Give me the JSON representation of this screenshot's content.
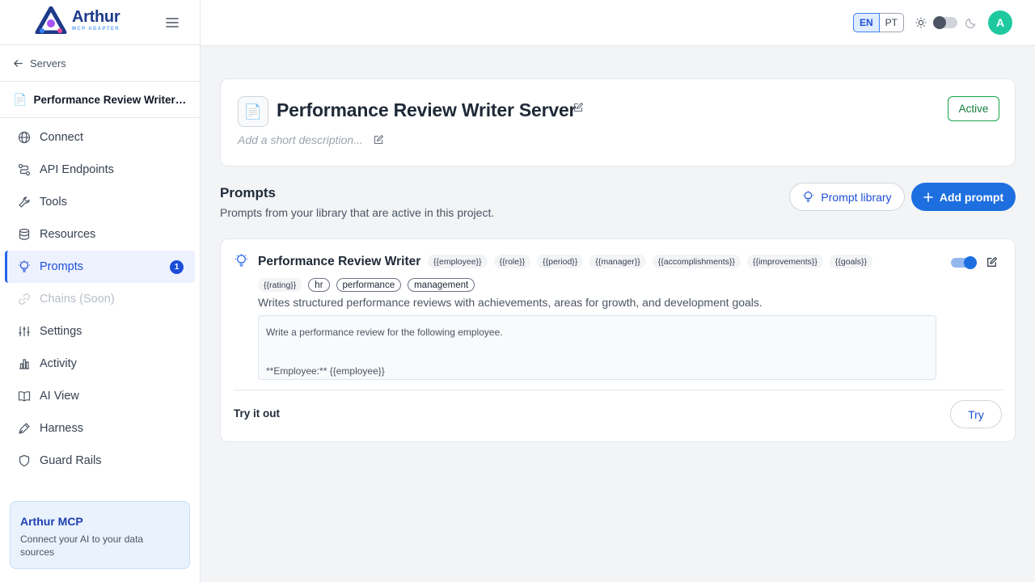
{
  "brand": {
    "title": "Arthur",
    "subtitle": "MCP ADAPTER",
    "color": "#1e3a8a"
  },
  "sidebar": {
    "back_label": "Servers",
    "server_name": "Performance Review Writer S...",
    "items": [
      {
        "label": "Connect",
        "icon": "globe-icon"
      },
      {
        "label": "API Endpoints",
        "icon": "endpoints-icon"
      },
      {
        "label": "Tools",
        "icon": "wrench-icon"
      },
      {
        "label": "Resources",
        "icon": "database-icon"
      },
      {
        "label": "Prompts",
        "icon": "lightbulb-icon",
        "badge": "1",
        "active": true
      },
      {
        "label": "Chains (Soon)",
        "icon": "link-icon",
        "disabled": true
      },
      {
        "label": "Settings",
        "icon": "sliders-icon"
      },
      {
        "label": "Activity",
        "icon": "bar-chart-icon"
      },
      {
        "label": "AI View",
        "icon": "book-icon"
      },
      {
        "label": "Harness",
        "icon": "pen-tool-icon"
      },
      {
        "label": "Guard Rails",
        "icon": "shield-icon"
      }
    ],
    "promo": {
      "title": "Arthur MCP",
      "text": "Connect your AI to your data sources"
    }
  },
  "topbar": {
    "lang_en": "EN",
    "lang_pt": "PT",
    "avatar": "A",
    "avatar_color": "#1fc9a0"
  },
  "server": {
    "title": "Performance Review Writer Server",
    "description_placeholder": "Add a short description...",
    "status": "Active"
  },
  "prompts": {
    "title": "Prompts",
    "subtitle": "Prompts from your library that are active in this project.",
    "library_button": "Prompt library",
    "add_button": "Add prompt",
    "item": {
      "name": "Performance Review Writer",
      "variables_row1": [
        "{{employee}}",
        "{{role}}",
        "{{period}}",
        "{{manager}}",
        "{{accomplishments}}",
        "{{improvements}}",
        "{{goals}}"
      ],
      "variables_row2": [
        "{{rating}}"
      ],
      "tags": [
        "hr",
        "performance",
        "management"
      ],
      "description": "Writes structured performance reviews with achievements, areas for growth, and development goals.",
      "body_line1": "Write a performance review for the following employee.",
      "body_line2": "**Employee:** {{employee}}",
      "enabled": true
    },
    "try_label": "Try it out",
    "try_button": "Try"
  },
  "colors": {
    "accent": "#1d6fe0",
    "active_status": "#15803d"
  }
}
